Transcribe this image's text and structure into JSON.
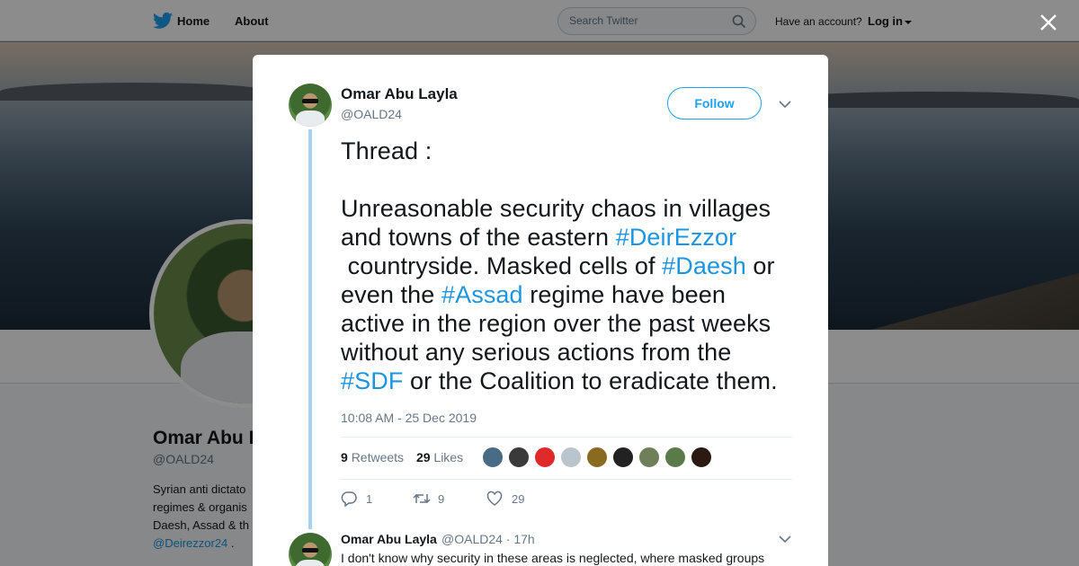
{
  "topbar": {
    "home_label": "Home",
    "about_label": "About",
    "search_placeholder": "Search Twitter",
    "have_account": "Have an account?",
    "login_label": "Log in"
  },
  "profile": {
    "name": "Omar Abu L",
    "handle": "@OALD24",
    "bio_lines": [
      "Syrian anti dictato",
      "regimes & organis",
      "Daesh, Assad & th"
    ],
    "bio_link": "@Deirezzor24",
    "bio_link_suffix": " ."
  },
  "tweet": {
    "author_name": "Omar Abu Layla",
    "author_handle": "@OALD24",
    "follow_label": "Follow",
    "text_lines": [
      [
        {
          "t": "Thread :"
        }
      ],
      [
        {
          "t": ""
        }
      ],
      [
        {
          "t": "Unreasonable security chaos in villages"
        }
      ],
      [
        {
          "t": "and towns of the eastern "
        },
        {
          "t": "#DeirEzzor",
          "tag": true
        }
      ],
      [
        {
          "t": " countryside. Masked cells of "
        },
        {
          "t": "#Daesh",
          "tag": true
        },
        {
          "t": " or"
        }
      ],
      [
        {
          "t": "even the "
        },
        {
          "t": "#Assad",
          "tag": true
        },
        {
          "t": " regime have been"
        }
      ],
      [
        {
          "t": "active in the region over the past weeks"
        }
      ],
      [
        {
          "t": "without any serious actions from the"
        }
      ],
      [
        {
          "t": "#SDF",
          "tag": true
        },
        {
          "t": " or the Coalition to eradicate them."
        }
      ]
    ],
    "timestamp": "10:08 AM - 25 Dec 2019",
    "retweets_count": "9",
    "retweets_label": "Retweets",
    "likes_count": "29",
    "likes_label": "Likes",
    "liker_avatars": [
      "#4a6b85",
      "#3a3a3a",
      "#e02a2a",
      "#b9c4cc",
      "#8a6a1e",
      "#222222",
      "#6f7f5a",
      "#5a7a4a",
      "#2b1a12"
    ],
    "reply_count": "1",
    "retweet_action_count": "9",
    "like_action_count": "29"
  },
  "reply": {
    "author_name": "Omar Abu Layla",
    "handle_time": "@OALD24 · 17h",
    "text": "I don't know why security in these areas is neglected, where masked groups"
  },
  "colors": {
    "accent": "#1da1f2",
    "hashtag": "#1b95e0",
    "thread_line": "#a6d2ef"
  }
}
